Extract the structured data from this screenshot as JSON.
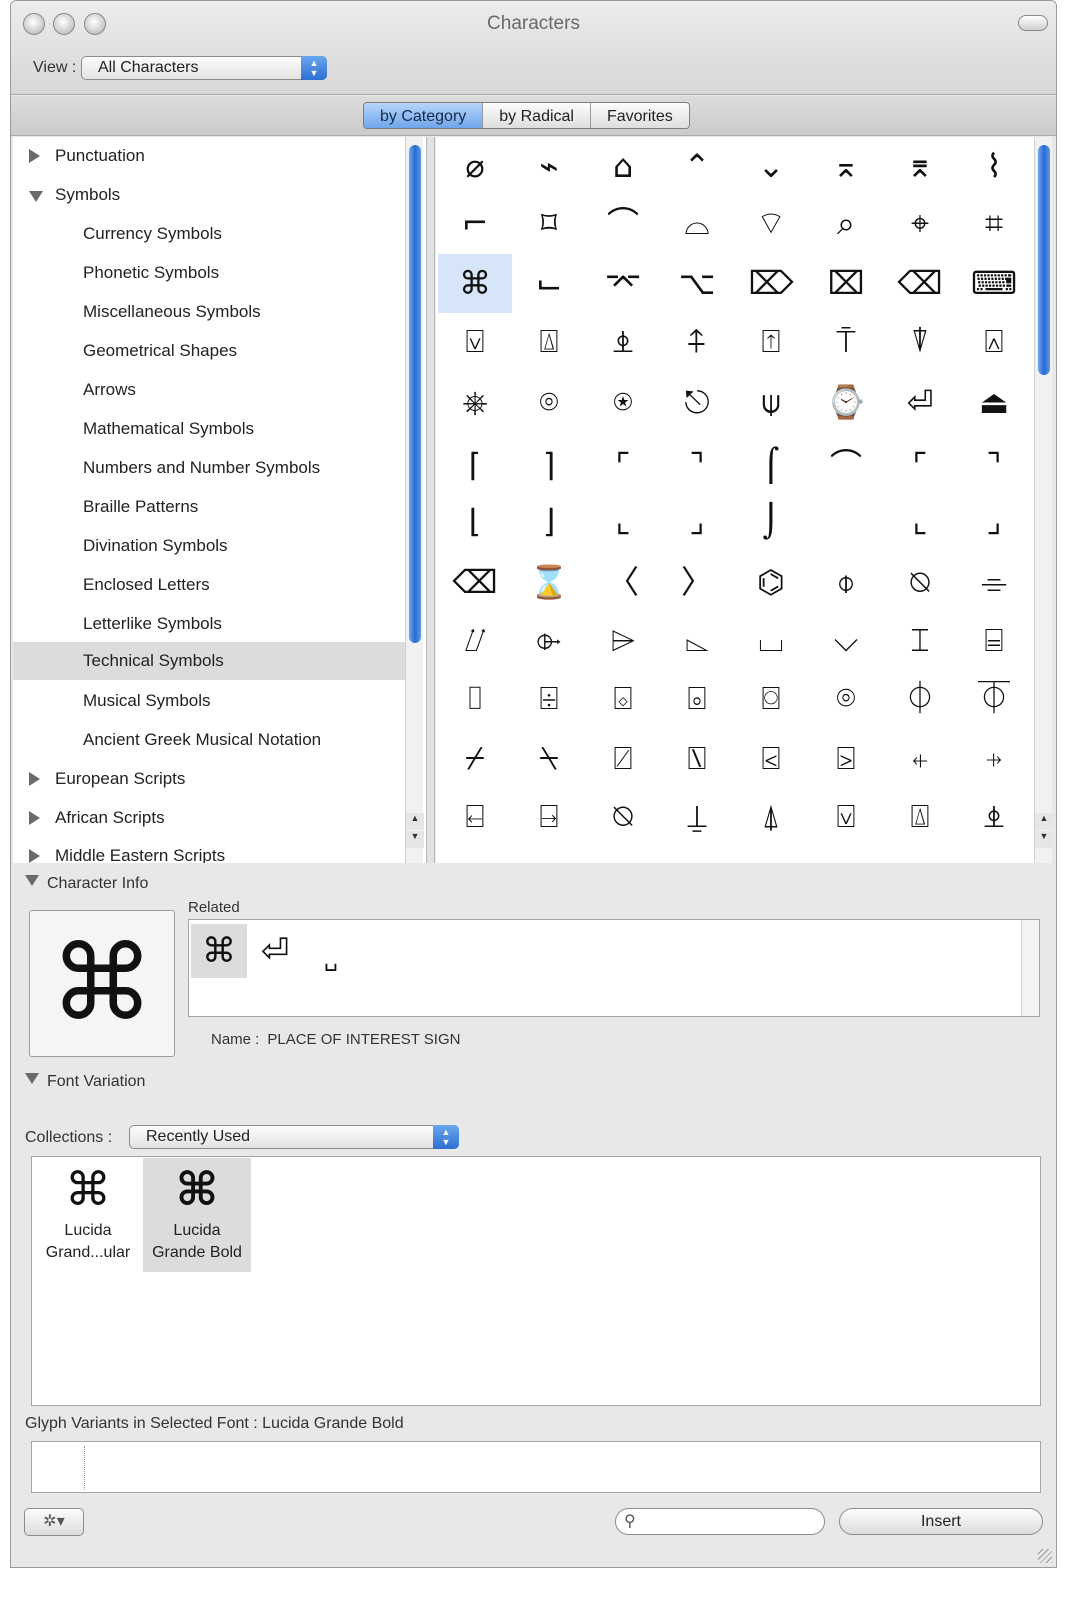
{
  "window": {
    "title": "Characters"
  },
  "toolbar": {
    "view_label": "View :",
    "view_value": "All Characters"
  },
  "tabs": [
    {
      "label": "by Category",
      "selected": true
    },
    {
      "label": "by Radical",
      "selected": false
    },
    {
      "label": "Favorites",
      "selected": false
    }
  ],
  "sidebar": {
    "items": [
      {
        "label": "Punctuation",
        "level": 0,
        "expanded": false
      },
      {
        "label": "Symbols",
        "level": 0,
        "expanded": true
      },
      {
        "label": "Currency Symbols",
        "level": 1
      },
      {
        "label": "Phonetic Symbols",
        "level": 1
      },
      {
        "label": "Miscellaneous Symbols",
        "level": 1
      },
      {
        "label": "Geometrical Shapes",
        "level": 1
      },
      {
        "label": "Arrows",
        "level": 1
      },
      {
        "label": "Mathematical Symbols",
        "level": 1
      },
      {
        "label": "Numbers and Number Symbols",
        "level": 1
      },
      {
        "label": "Braille Patterns",
        "level": 1
      },
      {
        "label": "Divination Symbols",
        "level": 1
      },
      {
        "label": "Enclosed Letters",
        "level": 1
      },
      {
        "label": "Letterlike Symbols",
        "level": 1
      },
      {
        "label": "Technical Symbols",
        "level": 1,
        "selected": true
      },
      {
        "label": "Musical Symbols",
        "level": 1
      },
      {
        "label": "Ancient Greek Musical Notation",
        "level": 1
      },
      {
        "label": "European Scripts",
        "level": 0,
        "expanded": false
      },
      {
        "label": "African Scripts",
        "level": 0,
        "expanded": false
      },
      {
        "label": "Middle Eastern Scripts",
        "level": 0,
        "expanded": false
      }
    ]
  },
  "grid": {
    "rows": [
      [
        "⌀",
        "⌁",
        "⌂",
        "⌃",
        "⌄",
        "⌅",
        "⌆",
        "⌇"
      ],
      [
        "⌐",
        "⌑",
        "⌒",
        "⌓",
        "⌔",
        "⌕",
        "⌖",
        "⌗"
      ],
      [
        "⌘",
        "⌙",
        "⌤",
        "⌥",
        "⌦",
        "⌧",
        "⌫",
        "⌨"
      ],
      [
        "⍌",
        "⍍",
        "⍎",
        "⍏",
        "⍐",
        "⍑",
        "⍒",
        "⍓"
      ],
      [
        "⎈",
        "⌾",
        "⍟",
        "⎋",
        "⍦",
        "⌚",
        "⏎",
        "⏏"
      ],
      [
        "⌈",
        "⌉",
        "⌜",
        "⌝",
        "⌠",
        "⌒",
        "⌜",
        "⌝"
      ],
      [
        "⌫",
        "⌛",
        "〈",
        "〉",
        "⌬",
        "⌽",
        "⍉",
        "⌯"
      ],
      [
        "⌰",
        "⌱",
        "⌲",
        "⌳",
        "⌴",
        "⌵",
        "⌶",
        "⌸"
      ],
      [
        "⌷",
        "⌹",
        "⌺",
        "⌻",
        "⌼",
        "⌾",
        "⏀",
        "⏁"
      ],
      [
        "⌿",
        "⍀",
        "⍁",
        "⍂",
        "⍃",
        "⍄",
        "⍅",
        "⍆"
      ],
      [
        "⍇",
        "⍈",
        "⍉",
        "⍊",
        "⍋",
        "⍌",
        "⍍",
        "⍎"
      ]
    ],
    "tall": {
      "row5": [
        "⌠",
        "⌡"
      ],
      "left_brackets": [
        "⌈",
        "⌊"
      ],
      "right_brackets": [
        "⌉",
        "⌋"
      ],
      "corner_tl": "⌜",
      "corner_tr": "⌝",
      "corner_bl": "⌞",
      "corner_br": "⌟"
    },
    "selected": "⌘"
  },
  "character_info": {
    "header": "Character Info",
    "glyph": "⌘",
    "related_label": "Related",
    "related": [
      "⌘",
      "⏎",
      "␣"
    ],
    "name_label": "Name :",
    "name_value": "PLACE OF INTEREST SIGN"
  },
  "font_variation": {
    "header": "Font Variation",
    "collections_label": "Collections :",
    "collections_value": "Recently Used",
    "fonts": [
      {
        "glyph": "⌘",
        "line1": "Lucida",
        "line2": "Grand...ular",
        "selected": false
      },
      {
        "glyph": "⌘",
        "line1": "Lucida",
        "line2": "Grande Bold",
        "selected": true
      }
    ],
    "glyph_variants_label": "Glyph Variants in Selected Font : Lucida Grande Bold"
  },
  "footer": {
    "gear": "✲▾",
    "search_icon": "⚲",
    "insert_label": "Insert"
  }
}
